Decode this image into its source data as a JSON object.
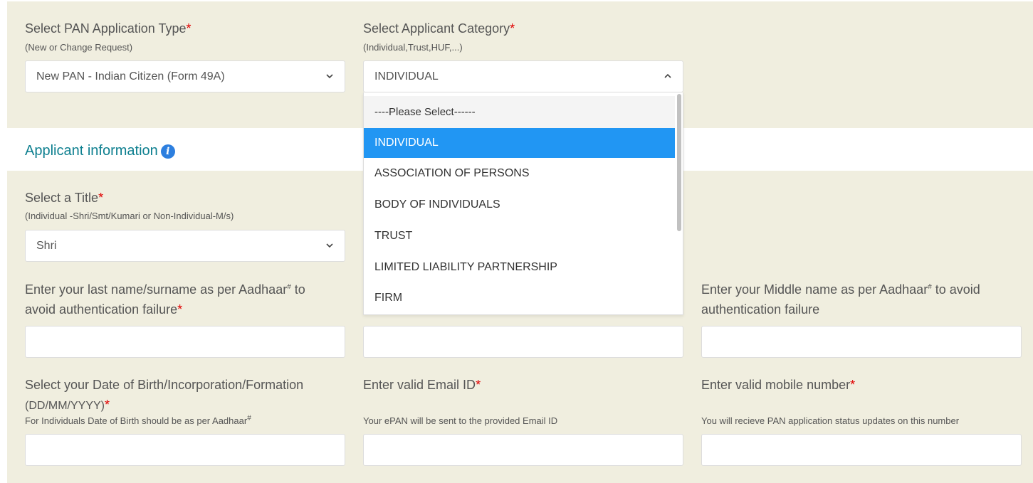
{
  "application_type": {
    "label": "Select PAN Application Type",
    "hint": "(New or Change Request)",
    "value": "New PAN - Indian Citizen (Form 49A)"
  },
  "applicant_category": {
    "label": "Select Applicant Category",
    "hint": "(Individual,Trust,HUF,...)",
    "value": "INDIVIDUAL",
    "options": [
      "----Please Select------",
      "INDIVIDUAL",
      "ASSOCIATION OF PERSONS",
      "BODY OF INDIVIDUALS",
      "TRUST",
      "LIMITED LIABILITY PARTNERSHIP",
      "FIRM"
    ],
    "selected_index": 1
  },
  "section": {
    "title": "Applicant information",
    "info_icon": "info-icon"
  },
  "title_field": {
    "label": "Select a Title",
    "hint": "(Individual -Shri/Smt/Kumari or Non-Individual-M/s)",
    "value": "Shri"
  },
  "last_name": {
    "label_line1": "Enter your last name/surname as per Aadhaar",
    "label_line1_end": " to",
    "label_line2": "avoid authentication failure",
    "sup": "#",
    "value": ""
  },
  "first_name": {
    "value": ""
  },
  "middle_name": {
    "label_line1": "Enter your Middle name as per Aadhaar",
    "label_line1_end": " to avoid",
    "label_line2": "authentication failure",
    "sup": "#",
    "value": ""
  },
  "dob": {
    "label_line1": "Select your Date of Birth/Incorporation/Formation",
    "label_line2": "(DD/MM/YYYY)",
    "hint": "For Individuals Date of Birth should be as per Aadhaar",
    "sup": "#",
    "value": ""
  },
  "email": {
    "label": "Enter valid Email ID",
    "hint": "Your ePAN will be sent to the provided Email ID",
    "value": ""
  },
  "mobile": {
    "label": "Enter valid mobile number",
    "hint": "You will recieve PAN application status updates on this number",
    "value": ""
  },
  "required_mark": "*",
  "colors": {
    "band": "#f0eedf",
    "accent": "#0d7f8f",
    "selected": "#2196f3",
    "required": "#e00000",
    "info": "#2d7fdf"
  }
}
